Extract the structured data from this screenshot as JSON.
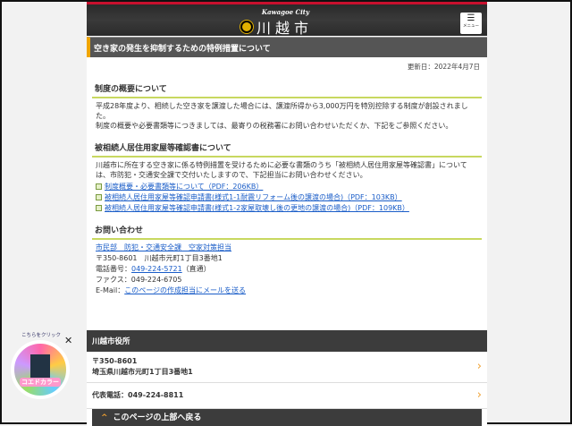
{
  "header": {
    "logo_en": "Kawagoe City",
    "logo_jp": "川越市",
    "menu_label": "メニュー"
  },
  "page_title": "空き家の発生を抑制するための特例措置について",
  "updated": "更新日：2022年4月7日",
  "sections": [
    {
      "heading": "制度の概要について",
      "paragraphs": [
        "平成28年度より、相続した空き家を譲渡した場合には、譲渡所得から3,000万円を特別控除する制度が創設されました。",
        "制度の概要や必要書類等につきましては、最寄りの税務署にお問い合わせいただくか、下記をご参照ください。"
      ]
    },
    {
      "heading": "被相続人居住用家屋等確認書について",
      "paragraphs": [
        "川越市に所在する空き家に係る特例措置を受けるために必要な書類のうち「被相続人居住用家屋等確認書」については、市防犯・交通安全課で交付いたしますので、下記担当にお問い合わせください。"
      ],
      "links": [
        "制度概要・必要書類等について（PDF：206KB）",
        "被相続人居住用家屋等確認申請書(様式1-1耐震リフォーム後の譲渡の場合)（PDF：103KB）",
        "被相続人居住用家屋等確認申請書(様式1-2家屋取壊し後の更地の譲渡の場合)（PDF：109KB）"
      ]
    },
    {
      "heading": "お問い合わせ"
    }
  ],
  "contact": {
    "dept": "市民部　防犯・交通安全課　空家対策担当",
    "address": "〒350-8601　川越市元町1丁目3番地1",
    "tel_label": "電話番号：",
    "tel": "049-224-5721",
    "tel_note": "（直通）",
    "fax": "ファクス：049-224-6705",
    "email_label": "E-Mail：",
    "email_link": "このページの作成担当にメールを送る"
  },
  "footer": {
    "title": "川越市役所",
    "postal": "〒350-8601",
    "address": "埼玉県川越市元町1丁目3番地1",
    "phone": "代表電話：049-224-8811",
    "back_to_top": "このページの上部へ戻る"
  },
  "badge": {
    "caption": "こちらをクリック",
    "name": "コエドカラー"
  },
  "colors": {
    "accent": "#f0a500",
    "heading_rule": "#c8d860",
    "link": "#1a5dc8"
  }
}
